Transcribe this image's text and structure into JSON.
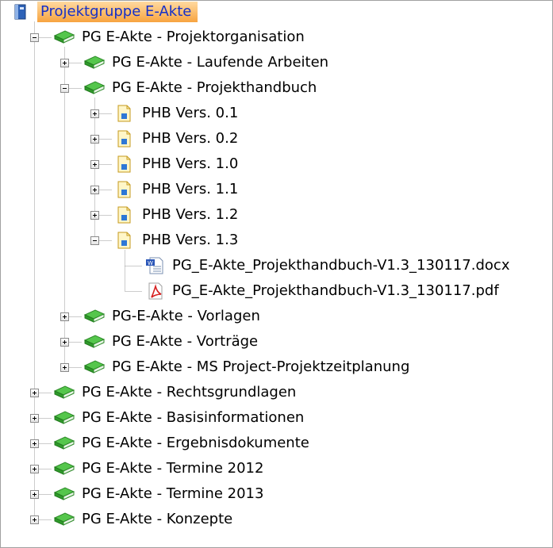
{
  "tree": {
    "root": {
      "label": "Projektgruppe E-Akte",
      "icon": "binder-icon",
      "expanded": true
    },
    "nodes": [
      {
        "label": "PG E-Akte - Projektorganisation",
        "level": 1,
        "icon": "green-book-icon",
        "expanded": true
      },
      {
        "label": "PG E-Akte - Laufende Arbeiten",
        "level": 2,
        "icon": "green-book-icon",
        "expanded": false
      },
      {
        "label": "PG E-Akte - Projekthandbuch",
        "level": 2,
        "icon": "green-book-icon",
        "expanded": true
      },
      {
        "label": "PHB Vers. 0.1",
        "level": 3,
        "icon": "yellow-file-icon",
        "expanded": false
      },
      {
        "label": "PHB Vers. 0.2",
        "level": 3,
        "icon": "yellow-file-icon",
        "expanded": false
      },
      {
        "label": "PHB Vers. 1.0",
        "level": 3,
        "icon": "yellow-file-icon",
        "expanded": false
      },
      {
        "label": "PHB Vers. 1.1",
        "level": 3,
        "icon": "yellow-file-icon",
        "expanded": false
      },
      {
        "label": "PHB Vers. 1.2",
        "level": 3,
        "icon": "yellow-file-icon",
        "expanded": false
      },
      {
        "label": "PHB Vers. 1.3",
        "level": 3,
        "icon": "yellow-file-icon",
        "expanded": true
      },
      {
        "label": "PG_E-Akte_Projekthandbuch-V1.3_130117.docx",
        "level": 4,
        "icon": "word-document-icon",
        "leaf": true
      },
      {
        "label": "PG_E-Akte_Projekthandbuch-V1.3_130117.pdf",
        "level": 4,
        "icon": "pdf-document-icon",
        "leaf": true
      },
      {
        "label": "PG-E-Akte - Vorlagen",
        "level": 2,
        "icon": "green-book-icon",
        "expanded": false
      },
      {
        "label": "PG E-Akte - Vorträge",
        "level": 2,
        "icon": "green-book-icon",
        "expanded": false
      },
      {
        "label": "PG E-Akte - MS Project-Projektzeitplanung",
        "level": 2,
        "icon": "green-book-icon",
        "expanded": false
      },
      {
        "label": "PG E-Akte - Rechtsgrundlagen",
        "level": 1,
        "icon": "green-book-icon",
        "expanded": false
      },
      {
        "label": "PG E-Akte - Basisinformationen",
        "level": 1,
        "icon": "green-book-icon",
        "expanded": false
      },
      {
        "label": "PG E-Akte - Ergebnisdokumente",
        "level": 1,
        "icon": "green-book-icon",
        "expanded": false
      },
      {
        "label": "PG E-Akte - Termine 2012",
        "level": 1,
        "icon": "green-book-icon",
        "expanded": false
      },
      {
        "label": "PG E-Akte - Termine 2013",
        "level": 1,
        "icon": "green-book-icon",
        "expanded": false
      },
      {
        "label": "PG E-Akte - Konzepte",
        "level": 1,
        "icon": "green-book-icon",
        "expanded": false
      }
    ]
  },
  "colors": {
    "root_highlight_top": "#ffd9a0",
    "root_highlight_bottom": "#f7a440",
    "root_text": "#1530c8",
    "book_green": "#3fae3a",
    "connector": "#9a9a9a"
  }
}
